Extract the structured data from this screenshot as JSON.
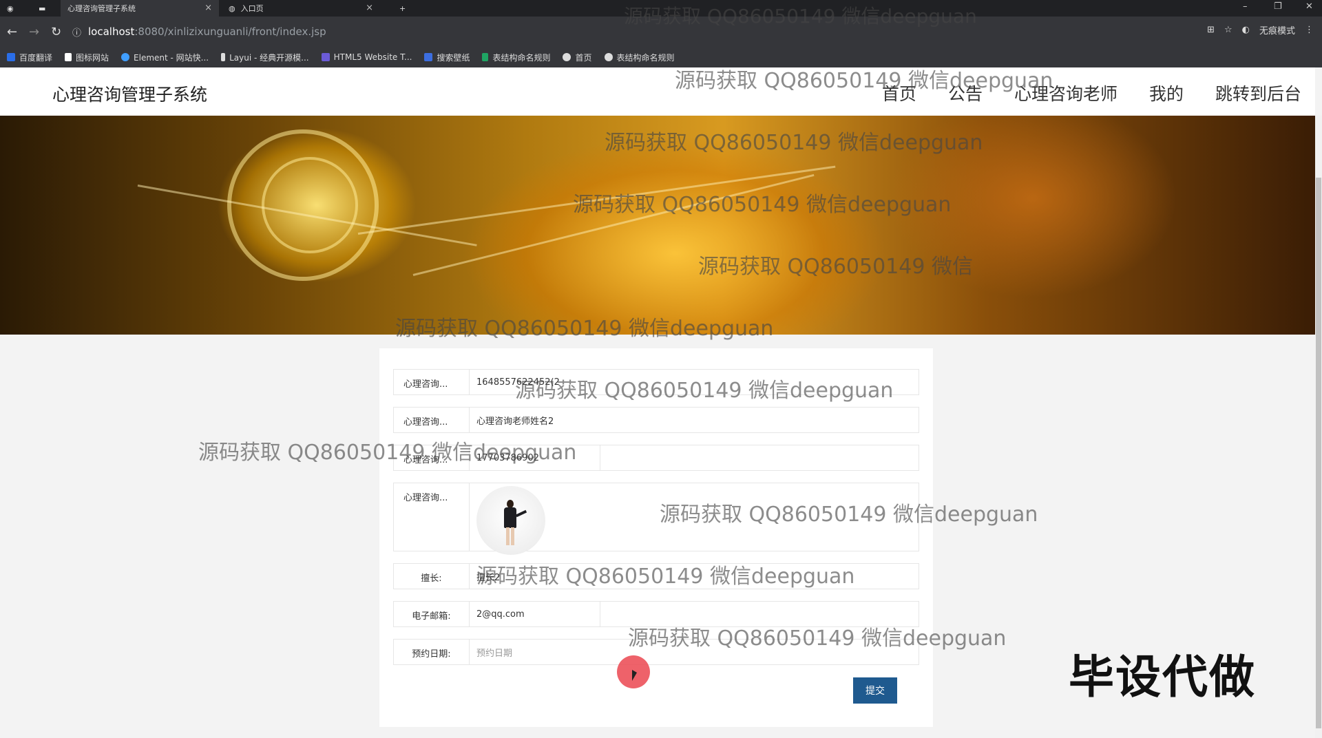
{
  "browser": {
    "tabs": [
      {
        "title": "心理咨询管理子系统",
        "active": true
      },
      {
        "title": "入口页",
        "active": false
      }
    ],
    "url_host": "localhost",
    "url_path": ":8080/xinlizixunguanli/front/index.jsp",
    "incognito_label": "无痕模式",
    "bookmarks": [
      {
        "label": "百度翻译",
        "color": "#2a6ee8"
      },
      {
        "label": "图标网站",
        "color": "#ffffff"
      },
      {
        "label": "Element - 网站快...",
        "color": "#409eff"
      },
      {
        "label": "Layui - 经典开源模...",
        "color": "#dddddd"
      },
      {
        "label": "HTML5 Website T...",
        "color": "#6b5bd6"
      },
      {
        "label": "搜索壁纸",
        "color": "#3c6ee0"
      },
      {
        "label": "表结构命名规则",
        "color": "#1fa463"
      },
      {
        "label": "首页",
        "color": "#dddddd"
      },
      {
        "label": "表结构命名规则",
        "color": "#dddddd"
      }
    ]
  },
  "header": {
    "site_title": "心理咨询管理子系统",
    "nav": [
      "首页",
      "公告",
      "心理咨询老师",
      "我的",
      "跳转到后台"
    ]
  },
  "form": {
    "rows": [
      {
        "label": "心理咨询...",
        "value": "1648557622452(2"
      },
      {
        "label": "心理咨询...",
        "value": "心理咨询老师姓名2"
      },
      {
        "label": "心理咨询...",
        "value": "17703786902"
      },
      {
        "label": "心理咨询...",
        "value": ""
      },
      {
        "label": "擅长:",
        "value": "擅长2"
      },
      {
        "label": "电子邮箱:",
        "value": "2@qq.com"
      },
      {
        "label": "预约日期:",
        "value": "",
        "placeholder": "预约日期"
      }
    ],
    "submit_label": "提交"
  },
  "watermark_text": "源码获取 QQ86050149 微信deepguan",
  "watermark_partial": "源码获取 QQ86050149 微信",
  "corner_stamp": "毕设代做",
  "colors": {
    "accent": "#1f5a8f",
    "cursor_highlight": "#eb4650"
  }
}
